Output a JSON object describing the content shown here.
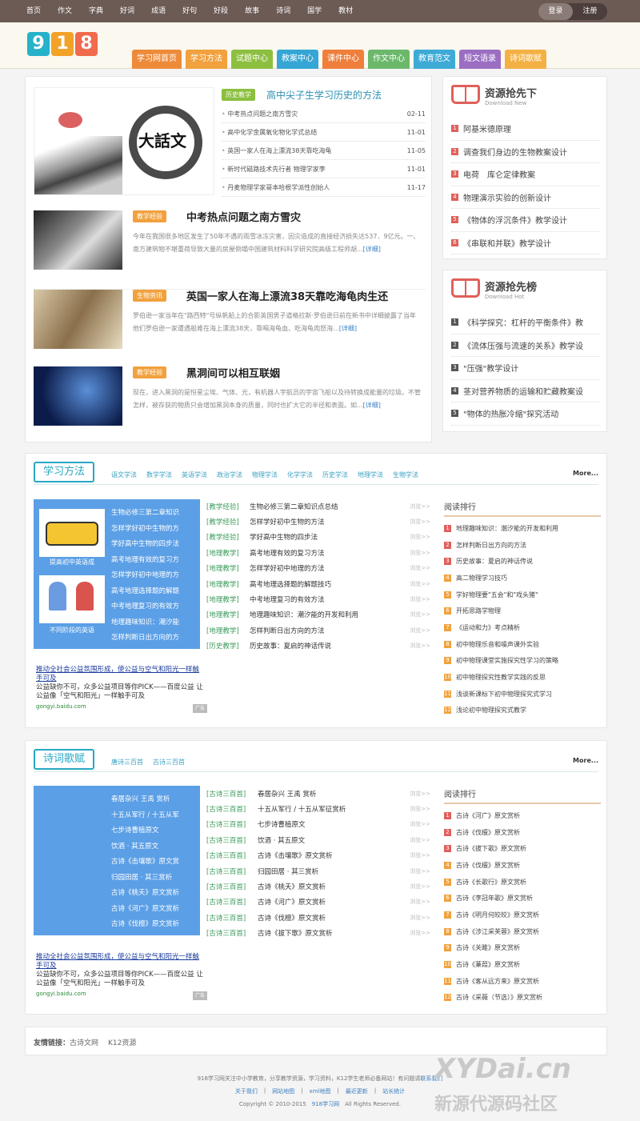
{
  "topnav": [
    "首页",
    "作文",
    "字典",
    "好词",
    "成语",
    "好句",
    "好段",
    "故事",
    "诗词",
    "国学",
    "教材"
  ],
  "login": {
    "login": "登录",
    "register": "注册"
  },
  "logo": [
    "9",
    "1",
    "8"
  ],
  "mainnav": [
    "学习网首页",
    "学习方法",
    "试题中心",
    "教案中心",
    "课件中心",
    "作文中心",
    "教育范文",
    "短文语录",
    "诗词歌赋"
  ],
  "colors": {
    "logo": [
      "#26b2c9",
      "#f3a228",
      "#f06a4c"
    ],
    "nav": [
      "#ee8b3a",
      "#f1a13d",
      "#8cbf3f",
      "#35a6d5",
      "#ef7f3b",
      "#6bb86b",
      "#3eaad6",
      "#9b6ec2",
      "#f3b144"
    ]
  },
  "headline": {
    "tag": "历史教学",
    "title": "高中尖子生学习历史的方法",
    "img_text": "大話文",
    "list": [
      {
        "t": "中考热点问题之南方雪灾",
        "d": "02-11"
      },
      {
        "t": "高中化学金属氧化物化学式总结",
        "d": "11-01"
      },
      {
        "t": "英国一家人在海上漂流38天靠吃海龟",
        "d": "11-05"
      },
      {
        "t": "新时代磁路技术先行者 物理学家李",
        "d": "11-01"
      },
      {
        "t": "丹麦物理学家哥本哈根学派性创始人",
        "d": "11-17"
      }
    ]
  },
  "articles": [
    {
      "tag": "教学经验",
      "title": "中考热点问题之南方雪灾",
      "desc": "今年在我国很多地区发生了50年不遇的雨雪冰冻灾害，因灾造成的直接经济损失达537．9亿元。一、南方建筑物不堪重荷导致大量的房屋倒塌中国建筑材料科学研究院高级工程师胡...",
      "more": "[详细]"
    },
    {
      "tag": "生物资讯",
      "title": "英国一家人在海上漂流38天靠吃海龟肉生还",
      "desc": "罗伯逊一家当年在\"路西特\"号纵帆船上的合影英国男子道格拉斯·罗伯逊日前在新书中详细披露了当年他们罗伯逊一家遭遇船难在海上漂流38天，靠喝海龟血、吃海龟肉怒海...",
      "more": "[详细]"
    },
    {
      "tag": "教学经验",
      "title": "黑洞间可以相互联姻",
      "desc": "现在，进入黑洞的是恒星尘埃、气体、光，有机器人宇航员的宇宙飞船以及待转换成能量的垃圾。不管怎样，被存获的物质只会增加黑洞本身的质量，同时也扩大它的半径和表面。如...",
      "more": "[详细]"
    }
  ],
  "side1": {
    "title": "资源抢先下",
    "sub": "Download New",
    "items": [
      "阿基米德原理",
      "调查我们身边的生物教案设计",
      "电荷　库仑定律教案",
      "物理演示实验的创新设计",
      "《物体的浮沉条件》教学设计",
      "《串联和并联》教学设计"
    ]
  },
  "side2": {
    "title": "资源抢先榜",
    "sub": "Download Hot",
    "items": [
      "《科学探究：杠杆的平衡条件》教",
      "《流体压强与流速的关系》教学设",
      "\"压强\"教学设计",
      "茎对营养物质的运输和贮藏教案设",
      "\"物体的热胀冷缩\"探究活动"
    ]
  },
  "sec1": {
    "title": "学习方法",
    "links": [
      "语文学法",
      "数学学法",
      "英语学法",
      "政治学法",
      "物理学法",
      "化学学法",
      "历史学法",
      "地理学法",
      "生物学法"
    ],
    "more": "More...",
    "img1": "提高初中英语成",
    "img2": "不同阶段的英语",
    "blue": [
      "生物必修三第二章知识",
      "怎样学好初中生物的方",
      "学好高中生物的四步法",
      "高考地理有效的复习方",
      "怎样学好初中地理的方",
      "高考地理选择题的解题",
      "中考地理复习的有效方",
      "地理趣味知识：潮汐能",
      "怎样判断日出方向的方"
    ],
    "list": [
      {
        "c": "[教学经验]",
        "t": "生物必修三第二章知识点总结"
      },
      {
        "c": "[教学经验]",
        "t": "怎样学好初中生物的方法"
      },
      {
        "c": "[教学经验]",
        "t": "学好高中生物的四步法"
      },
      {
        "c": "[地理教学]",
        "t": "高考地理有效的复习方法"
      },
      {
        "c": "[地理教学]",
        "t": "怎样学好初中地理的方法"
      },
      {
        "c": "[地理教学]",
        "t": "高考地理选择题的解题技巧"
      },
      {
        "c": "[地理教学]",
        "t": "中考地理复习的有效方法"
      },
      {
        "c": "[地理教学]",
        "t": "地理趣味知识：潮汐能的开发和利用"
      },
      {
        "c": "[地理教学]",
        "t": "怎样判断日出方向的方法"
      },
      {
        "c": "[历史教学]",
        "t": "历史故事：夏启的神话传说"
      }
    ],
    "views": "浏览>>",
    "rank_title": "阅读排行",
    "rank": [
      "地理趣味知识：潮汐能的开发和利用",
      "怎样判断日出方向的方法",
      "历史故事：夏启的神话传说",
      "高二物理学习技巧",
      "学好物理要\"五会\"和\"戏头猪\"",
      "开拓思路学物理",
      "《运动和力》考点精析",
      "初中物理乐音和噪声课外实验",
      "初中物理课堂实施探究性学习的策略",
      "初中物理探究性教学实践的反思",
      "浅谈新课标下初中物理探究式学习",
      "浅论初中物理探究式教学"
    ],
    "ad": {
      "link": "推动全社会公益氛围形成，使公益与空气和阳光一样触手可及",
      "text": "公益缺你不可，众多公益项目等你PICK——百度公益 让公益像「空气和阳光」一样触手可及",
      "url": "gongyi.baidu.com",
      "tip": "广告"
    }
  },
  "sec2": {
    "title": "诗词歌赋",
    "links": [
      "唐诗三百首",
      "古诗三百首"
    ],
    "more": "More...",
    "blue": [
      "春居杂兴 王禹 赏析",
      "十五从军行 / 十五从军",
      "七步诗曹植原文",
      "饮酒 · 其五原文",
      "古诗《击壤歌》原文赏",
      "归园田居 · 其三赏析",
      "古诗《桃夭》原文赏析",
      "古诗《河广》原文赏析",
      "古诗《伐檀》原文赏析"
    ],
    "list": [
      {
        "c": "[古诗三百首]",
        "t": "春居杂兴 王禹 赏析"
      },
      {
        "c": "[古诗三百首]",
        "t": "十五从军行 / 十五从军征赏析"
      },
      {
        "c": "[古诗三百首]",
        "t": "七步诗曹植原文"
      },
      {
        "c": "[古诗三百首]",
        "t": "饮酒 · 其五原文"
      },
      {
        "c": "[古诗三百首]",
        "t": "古诗《击壤歌》原文赏析"
      },
      {
        "c": "[古诗三百首]",
        "t": "归园田居 · 其三赏析"
      },
      {
        "c": "[古诗三百首]",
        "t": "古诗《桃夭》原文赏析"
      },
      {
        "c": "[古诗三百首]",
        "t": "古诗《河广》原文赏析"
      },
      {
        "c": "[古诗三百首]",
        "t": "古诗《伐檀》原文赏析"
      },
      {
        "c": "[古诗三百首]",
        "t": "古诗《拔下歌》原文赏析"
      }
    ],
    "views": "浏览>>",
    "rank_title": "阅读排行",
    "rank": [
      "古诗《河广》原文赏析",
      "古诗《伐檀》原文赏析",
      "古诗《拔下歌》原文赏析",
      "古诗《伐檀》原文赏析",
      "古诗《长歌行》原文赏析",
      "古诗《李冠年歌》原文赏析",
      "古诗《明月何皎皎》原文赏析",
      "古诗《涉江采芙蓉》原文赏析",
      "古诗《关雎》原文赏析",
      "古诗《蒹葭》原文赏析",
      "古诗《客从远方来》原文赏析",
      "古诗《采薇（节选）》原文赏析"
    ],
    "ad": {
      "link": "推动全社会公益氛围形成，使公益与空气和阳光一样触手可及",
      "text": "公益缺你不可，众多公益项目等你PICK——百度公益 让公益像「空气和阳光」一样触手可及",
      "url": "gongyi.baidu.com",
      "tip": "广告"
    }
  },
  "friend": {
    "label": "友情链接：",
    "links": [
      "古诗文网",
      "K12资源"
    ]
  },
  "footer": {
    "line1": "918学习网关注中小学教育，分享教学资源，学习资料，K12学生老师必备网站！有问题请",
    "contact": "联系我们",
    "links": [
      "关于我们",
      "网站地图",
      "xml地图",
      "最近更新",
      "站长统计"
    ],
    "copy": "Copyright © 2010-2015",
    "site": "918学习网",
    "rights": "All Rights Reserved."
  },
  "watermark": {
    "l1": "XYDai.cn",
    "l2": "新源代源码社区"
  }
}
